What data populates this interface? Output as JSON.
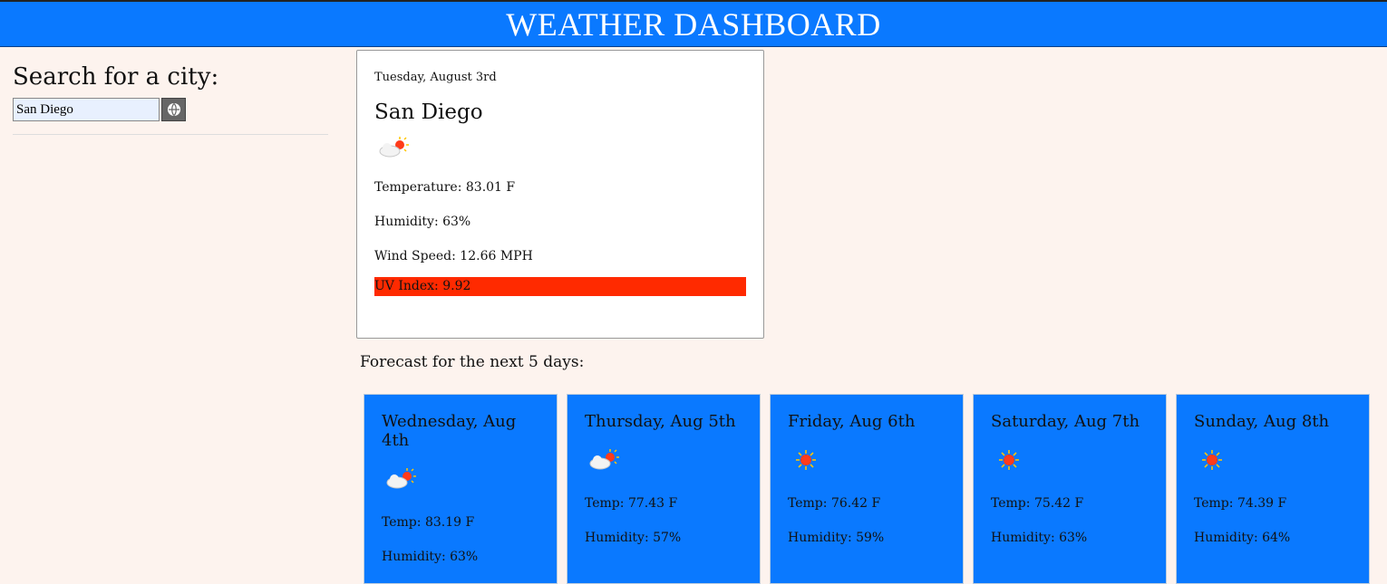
{
  "header": {
    "title": "WEATHER DASHBOARD"
  },
  "sidebar": {
    "search_label": "Search for a city:",
    "search_value": "San Diego",
    "search_button_icon": "globe-icon"
  },
  "current": {
    "date": "Tuesday, August 3rd",
    "city": "San Diego",
    "icon": "partly-cloudy-icon",
    "temperature": "Temperature: 83.01 F",
    "humidity": "Humidity: 63%",
    "wind_speed": "Wind Speed: 12.66 MPH",
    "uv_index": "UV Index: 9.92",
    "uv_color": "#ff2a00"
  },
  "forecast": {
    "title": "Forecast for the next 5 days:",
    "days": [
      {
        "day": "Wednesday, Aug 4th",
        "icon": "partly-cloudy-icon",
        "temp": "Temp: 83.19 F",
        "humidity": "Humidity: 63%"
      },
      {
        "day": "Thursday, Aug 5th",
        "icon": "partly-cloudy-icon",
        "temp": "Temp: 77.43 F",
        "humidity": "Humidity: 57%"
      },
      {
        "day": "Friday, Aug 6th",
        "icon": "sun-icon",
        "temp": "Temp: 76.42 F",
        "humidity": "Humidity: 59%"
      },
      {
        "day": "Saturday, Aug 7th",
        "icon": "sun-icon",
        "temp": "Temp: 75.42 F",
        "humidity": "Humidity: 63%"
      },
      {
        "day": "Sunday, Aug 8th",
        "icon": "sun-icon",
        "temp": "Temp: 74.39 F",
        "humidity": "Humidity: 64%"
      }
    ]
  },
  "colors": {
    "accent": "#0a79ff",
    "background": "#fdf3ee",
    "uv_high": "#ff2a00"
  }
}
